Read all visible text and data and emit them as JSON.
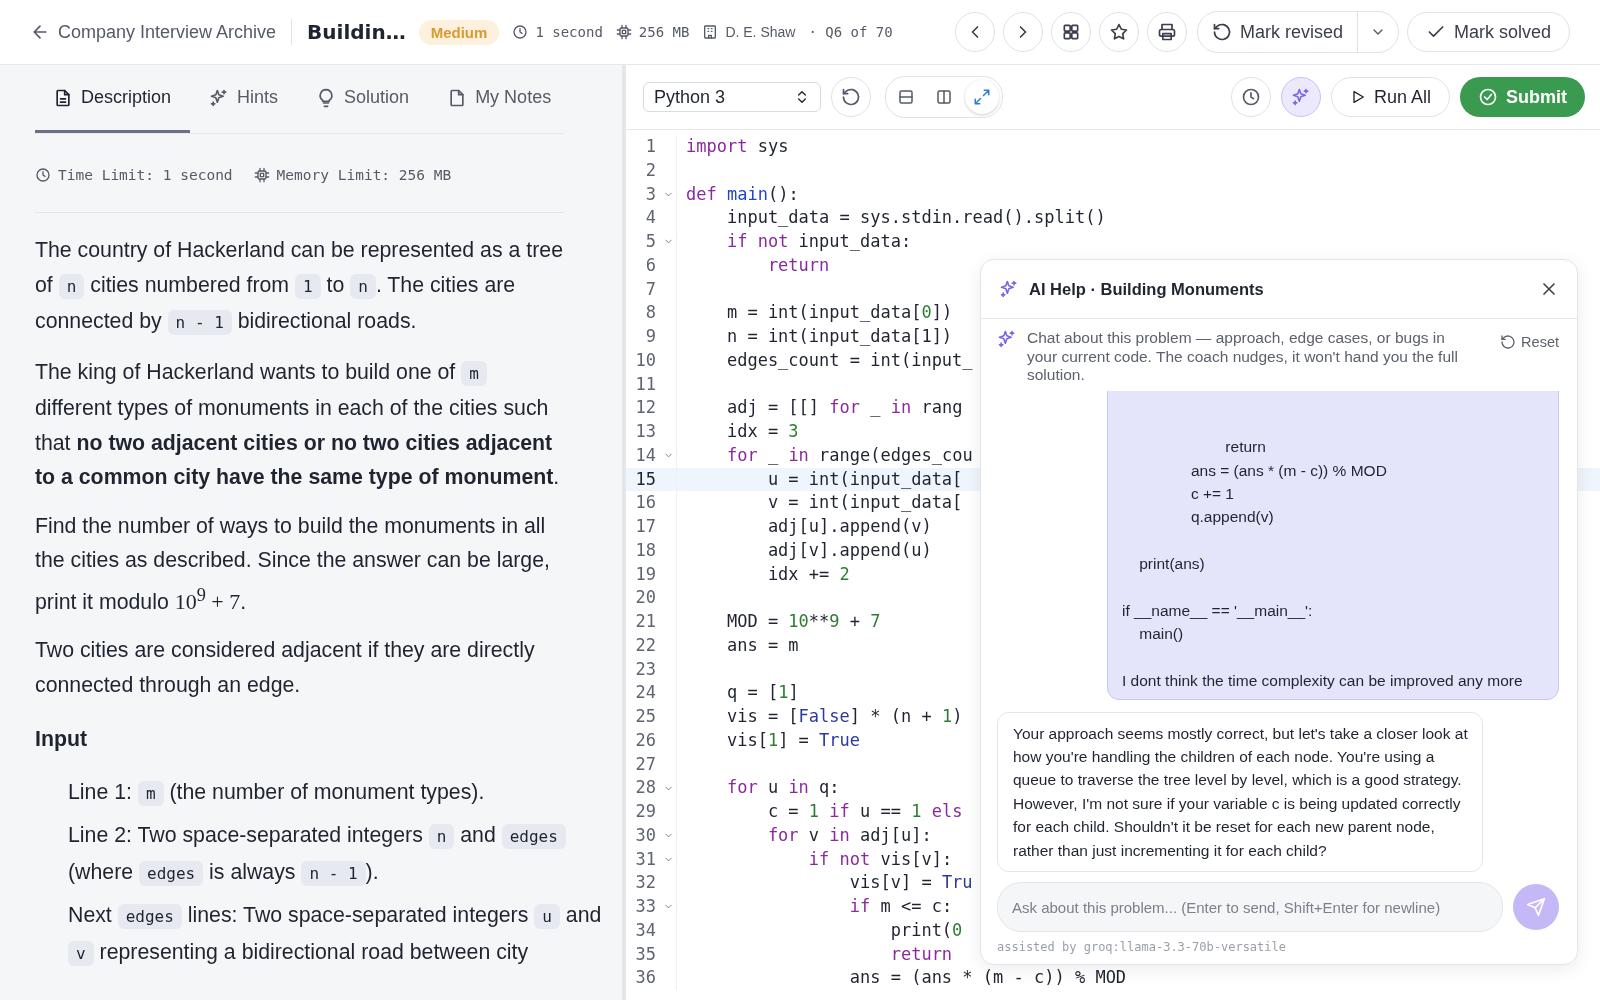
{
  "topbar": {
    "back_link": "Company Interview Archive",
    "title": "Buildin…",
    "difficulty": "Medium",
    "time": "1 second",
    "memory": "256 MB",
    "company": "D. E. Shaw",
    "position": "· Q6 of 70",
    "revise_button": "Mark revised",
    "solve_button": "Mark solved"
  },
  "tabs": [
    {
      "label": "Description",
      "selected": true
    },
    {
      "label": "Hints",
      "selected": false
    },
    {
      "label": "Solution",
      "selected": false
    },
    {
      "label": "My Notes",
      "selected": false
    }
  ],
  "limits": {
    "time": "Time Limit: 1 second",
    "memory": "Memory Limit: 256 MB"
  },
  "description": [
    {
      "kind": "paragraph",
      "segments": [
        {
          "kind": "text",
          "text": "The country of Hackerland can be represented as a tree of "
        },
        {
          "kind": "code",
          "text": "n"
        },
        {
          "kind": "text",
          "text": " cities numbered from "
        },
        {
          "kind": "code",
          "text": "1"
        },
        {
          "kind": "text",
          "text": " to "
        },
        {
          "kind": "code",
          "text": "n"
        },
        {
          "kind": "text",
          "text": ". The cities are connected by "
        },
        {
          "kind": "code",
          "text": "n - 1"
        },
        {
          "kind": "text",
          "text": " bidirectional roads."
        }
      ]
    },
    {
      "kind": "paragraph",
      "segments": [
        {
          "kind": "text",
          "text": "The king of Hackerland wants to build one of "
        },
        {
          "kind": "code",
          "text": "m"
        },
        {
          "kind": "text",
          "text": " different types of monuments in each of the cities such that "
        },
        {
          "kind": "bold",
          "text": "no two adjacent cities or no two cities adjacent to a common city have the same type of monument"
        },
        {
          "kind": "text",
          "text": "."
        }
      ]
    },
    {
      "kind": "paragraph",
      "segments": [
        {
          "kind": "text",
          "text": "Find the number of ways to build the monuments in all the cities as described. Since the answer can be large, print it modulo "
        },
        {
          "kind": "math",
          "text": "10$^{9}$ + 7"
        },
        {
          "kind": "text",
          "text": "."
        }
      ]
    },
    {
      "kind": "paragraph",
      "segments": [
        {
          "kind": "text",
          "text": "Two cities are considered adjacent if they are directly connected through an edge."
        }
      ]
    },
    {
      "kind": "heading",
      "segments": [
        {
          "kind": "text",
          "text": "Input"
        }
      ]
    },
    {
      "kind": "list_item",
      "segments": [
        {
          "kind": "text",
          "text": "Line 1: "
        },
        {
          "kind": "code",
          "text": "m"
        },
        {
          "kind": "text",
          "text": " (the number of monument types)."
        }
      ]
    },
    {
      "kind": "list_item",
      "segments": [
        {
          "kind": "text",
          "text": "Line 2: Two space-separated integers "
        },
        {
          "kind": "code",
          "text": "n"
        },
        {
          "kind": "text",
          "text": " and "
        },
        {
          "kind": "code",
          "text": "edges"
        },
        {
          "kind": "text",
          "text": " (where "
        },
        {
          "kind": "code",
          "text": "edges"
        },
        {
          "kind": "text",
          "text": " is always "
        },
        {
          "kind": "code",
          "text": "n - 1"
        },
        {
          "kind": "text",
          "text": ")."
        }
      ]
    },
    {
      "kind": "list_item",
      "segments": [
        {
          "kind": "text",
          "text": "Next "
        },
        {
          "kind": "code",
          "text": "edges"
        },
        {
          "kind": "text",
          "text": " lines: Two space-separated integers "
        },
        {
          "kind": "code",
          "text": "u"
        },
        {
          "kind": "text",
          "text": " and "
        },
        {
          "kind": "code",
          "text": "v"
        },
        {
          "kind": "text",
          "text": " representing a bidirectional road between city"
        }
      ]
    }
  ],
  "editor": {
    "language": "Python 3",
    "layout_buttons": [
      {
        "selected": false
      },
      {
        "selected": false
      },
      {
        "selected": true
      }
    ],
    "ai_selected": true,
    "run_button": "Run All",
    "submit_button": "Submit",
    "lines": [
      {
        "n": "1",
        "fold": false,
        "current": false,
        "tokens": [
          {
            "kind": "kw",
            "text": "import"
          },
          {
            "kind": "p",
            "text": " sys"
          }
        ]
      },
      {
        "n": "2",
        "fold": false,
        "current": false
      },
      {
        "n": "3",
        "fold": true,
        "current": false,
        "tokens": [
          {
            "kind": "kw",
            "text": "def"
          },
          {
            "kind": "fn",
            "text": " main"
          },
          {
            "kind": "p",
            "text": "():"
          }
        ]
      },
      {
        "n": "4",
        "fold": false,
        "current": false,
        "tokens": [
          {
            "kind": "p",
            "text": "    input_data = sys.stdin.read().split()"
          }
        ]
      },
      {
        "n": "5",
        "fold": true,
        "current": false,
        "tokens": [
          {
            "kind": "kw",
            "text": "    if"
          },
          {
            "kind": "kw",
            "text": " not"
          },
          {
            "kind": "p",
            "text": " input_data:"
          }
        ]
      },
      {
        "n": "6",
        "fold": false,
        "current": false,
        "tokens": [
          {
            "kind": "kw",
            "text": "        return"
          }
        ]
      },
      {
        "n": "7",
        "fold": false,
        "current": false
      },
      {
        "n": "8",
        "fold": false,
        "current": false,
        "tokens": [
          {
            "kind": "p",
            "text": "    m = int(input_data["
          },
          {
            "kind": "num",
            "text": "0"
          },
          {
            "kind": "p",
            "text": "])"
          }
        ]
      },
      {
        "n": "9",
        "fold": false,
        "current": false,
        "tokens": [
          {
            "kind": "p",
            "text": "    n = int(input_data[1])"
          }
        ]
      },
      {
        "n": "10",
        "fold": false,
        "current": false,
        "tokens": [
          {
            "kind": "p",
            "text": "    edges_count = int(input_"
          }
        ]
      },
      {
        "n": "11",
        "fold": false,
        "current": false
      },
      {
        "n": "12",
        "fold": false,
        "current": false,
        "tokens": [
          {
            "kind": "p",
            "text": "    adj = [[]"
          },
          {
            "kind": "kw",
            "text": " for"
          },
          {
            "kind": "p",
            "text": " _"
          },
          {
            "kind": "kw",
            "text": " in"
          },
          {
            "kind": "p",
            "text": " rang"
          }
        ]
      },
      {
        "n": "13",
        "fold": false,
        "current": false,
        "tokens": [
          {
            "kind": "p",
            "text": "    idx = "
          },
          {
            "kind": "num",
            "text": "3"
          }
        ]
      },
      {
        "n": "14",
        "fold": true,
        "current": false,
        "tokens": [
          {
            "kind": "kw",
            "text": "    for"
          },
          {
            "kind": "p",
            "text": " _"
          },
          {
            "kind": "kw",
            "text": " in"
          },
          {
            "kind": "p",
            "text": " range(edges_cou"
          }
        ]
      },
      {
        "n": "15",
        "fold": false,
        "current": true,
        "tokens": [
          {
            "kind": "p",
            "text": "        u = int(input_data["
          }
        ]
      },
      {
        "n": "16",
        "fold": false,
        "current": false,
        "tokens": [
          {
            "kind": "p",
            "text": "        v = int(input_data["
          }
        ]
      },
      {
        "n": "17",
        "fold": false,
        "current": false,
        "tokens": [
          {
            "kind": "p",
            "text": "        adj[u].append(v)"
          }
        ]
      },
      {
        "n": "18",
        "fold": false,
        "current": false,
        "tokens": [
          {
            "kind": "p",
            "text": "        adj[v].append(u)"
          }
        ]
      },
      {
        "n": "19",
        "fold": false,
        "current": false,
        "tokens": [
          {
            "kind": "p",
            "text": "        idx += "
          },
          {
            "kind": "num",
            "text": "2"
          }
        ]
      },
      {
        "n": "20",
        "fold": false,
        "current": false
      },
      {
        "n": "21",
        "fold": false,
        "current": false,
        "tokens": [
          {
            "kind": "p",
            "text": "    MOD = "
          },
          {
            "kind": "num",
            "text": "10"
          },
          {
            "kind": "p",
            "text": "**"
          },
          {
            "kind": "num",
            "text": "9"
          },
          {
            "kind": "p",
            "text": " + "
          },
          {
            "kind": "num",
            "text": "7"
          }
        ]
      },
      {
        "n": "22",
        "fold": false,
        "current": false,
        "tokens": [
          {
            "kind": "p",
            "text": "    ans = m"
          }
        ]
      },
      {
        "n": "23",
        "fold": false,
        "current": false
      },
      {
        "n": "24",
        "fold": false,
        "current": false,
        "tokens": [
          {
            "kind": "p",
            "text": "    q = ["
          },
          {
            "kind": "num",
            "text": "1"
          },
          {
            "kind": "p",
            "text": "]"
          }
        ]
      },
      {
        "n": "25",
        "fold": false,
        "current": false,
        "tokens": [
          {
            "kind": "p",
            "text": "    vis = ["
          },
          {
            "kind": "const",
            "text": "False"
          },
          {
            "kind": "p",
            "text": "] * (n + "
          },
          {
            "kind": "num",
            "text": "1"
          },
          {
            "kind": "p",
            "text": ")"
          }
        ]
      },
      {
        "n": "26",
        "fold": false,
        "current": false,
        "tokens": [
          {
            "kind": "p",
            "text": "    vis["
          },
          {
            "kind": "num",
            "text": "1"
          },
          {
            "kind": "p",
            "text": "] = "
          },
          {
            "kind": "const",
            "text": "True"
          }
        ]
      },
      {
        "n": "27",
        "fold": false,
        "current": false
      },
      {
        "n": "28",
        "fold": true,
        "current": false,
        "tokens": [
          {
            "kind": "kw",
            "text": "    for"
          },
          {
            "kind": "p",
            "text": " u"
          },
          {
            "kind": "kw",
            "text": " in"
          },
          {
            "kind": "p",
            "text": " q:"
          }
        ]
      },
      {
        "n": "29",
        "fold": false,
        "current": false,
        "tokens": [
          {
            "kind": "p",
            "text": "        c = "
          },
          {
            "kind": "num",
            "text": "1"
          },
          {
            "kind": "kw",
            "text": " if"
          },
          {
            "kind": "p",
            "text": " u == "
          },
          {
            "kind": "num",
            "text": "1"
          },
          {
            "kind": "kw",
            "text": " els"
          }
        ]
      },
      {
        "n": "30",
        "fold": true,
        "current": false,
        "tokens": [
          {
            "kind": "kw",
            "text": "        for"
          },
          {
            "kind": "p",
            "text": " v"
          },
          {
            "kind": "kw",
            "text": " in"
          },
          {
            "kind": "p",
            "text": " adj[u]:"
          }
        ]
      },
      {
        "n": "31",
        "fold": true,
        "current": false,
        "tokens": [
          {
            "kind": "kw",
            "text": "            if"
          },
          {
            "kind": "kw",
            "text": " not"
          },
          {
            "kind": "p",
            "text": " vis[v]:"
          }
        ]
      },
      {
        "n": "32",
        "fold": false,
        "current": false,
        "tokens": [
          {
            "kind": "p",
            "text": "                vis[v] = "
          },
          {
            "kind": "const",
            "text": "Tru"
          }
        ]
      },
      {
        "n": "33",
        "fold": true,
        "current": false,
        "tokens": [
          {
            "kind": "kw",
            "text": "                if"
          },
          {
            "kind": "p",
            "text": " m <= c:"
          }
        ]
      },
      {
        "n": "34",
        "fold": false,
        "current": false,
        "tokens": [
          {
            "kind": "p",
            "text": "                    print("
          },
          {
            "kind": "num",
            "text": "0"
          }
        ]
      },
      {
        "n": "35",
        "fold": false,
        "current": false,
        "tokens": [
          {
            "kind": "kw",
            "text": "                    return"
          }
        ]
      },
      {
        "n": "36",
        "fold": false,
        "current": false,
        "tokens": [
          {
            "kind": "p",
            "text": "                ans = (ans * (m - c)) % MOD"
          }
        ]
      }
    ]
  },
  "chat": {
    "title": "AI Help · Building Monuments",
    "intro": "Chat about this problem — approach, edge cases, or bugs in your current code. The coach nudges, it won't hand you the full solution.",
    "reset_button": "Reset",
    "messages": [
      {
        "kind": "user",
        "text": "                        return\n                ans = (ans * (m - c)) % MOD\n                c += 1\n                q.append(v)\n\n    print(ans)\n\nif __name__ == '__main__':\n    main()\n\nI dont think the time complexity can be improved any more"
      },
      {
        "kind": "assistant",
        "text": "Your approach seems mostly correct, but let's take a closer look at how you're handling the children of each node. You're using a queue to traverse the tree level by level, which is a good strategy. However, I'm not sure if your variable c is being updated correctly for each child. Shouldn't it be reset for each new parent node, rather than just incrementing it for each child?"
      }
    ],
    "input_placeholder": "Ask about this problem... (Enter to send, Shift+Enter for newline)",
    "footer": "assisted by groq:llama-3.3-70b-versatile"
  }
}
